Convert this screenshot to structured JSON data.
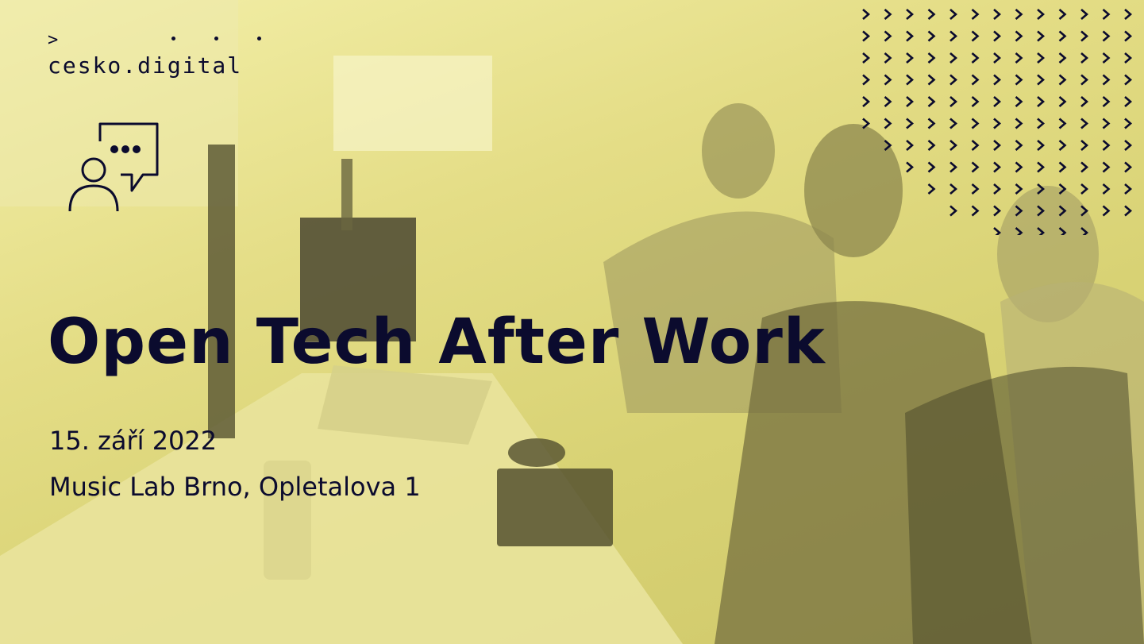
{
  "brand": {
    "caret": ">",
    "name": "cesko.digital"
  },
  "event": {
    "title": "Open Tech After Work",
    "date": "15. září 2022",
    "venue": "Music Lab Brno, Opletalova 1"
  },
  "icons": {
    "chat": "person-speech-bubble-icon",
    "pattern": "chevron-pattern"
  },
  "colors": {
    "ink": "#0b0b2e",
    "tint": "#e4dd86"
  }
}
